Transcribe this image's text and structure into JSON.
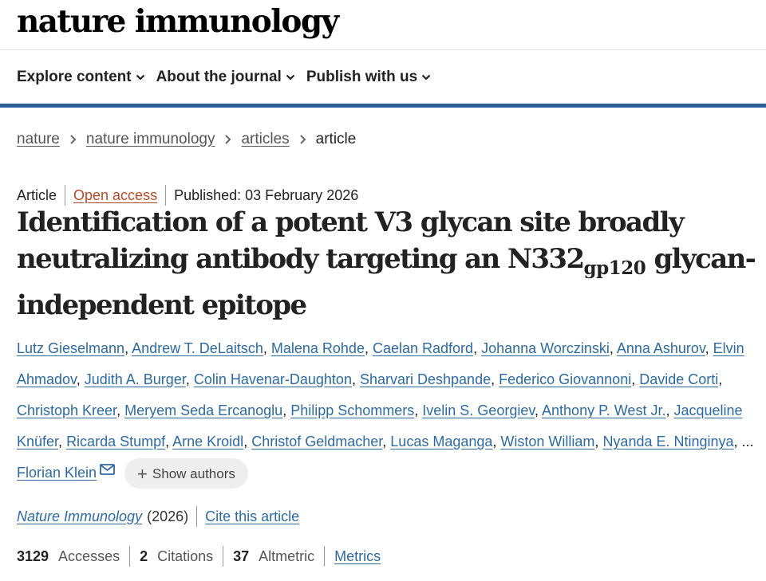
{
  "site": {
    "logo": "nature immunology"
  },
  "nav": {
    "items": [
      {
        "label": "Explore content"
      },
      {
        "label": "About the journal"
      },
      {
        "label": "Publish with us"
      }
    ]
  },
  "breadcrumb": {
    "items": [
      "nature",
      "nature immunology",
      "articles"
    ],
    "current": "article"
  },
  "article": {
    "type": "Article",
    "access": "Open access",
    "published": "Published: 03 February 2026",
    "title_part1": "Identification of a potent V3 glycan site broadly neutralizing antibody targeting an N332",
    "title_sub": "gp120",
    "title_part2": " glycan-independent epitope",
    "authors": [
      "Lutz Gieselmann",
      "Andrew T. DeLaitsch",
      "Malena Rohde",
      "Caelan Radford",
      "Johanna Worczinski",
      "Anna Ashurov",
      "Elvin Ahmadov",
      "Judith A. Burger",
      "Colin Havenar-Daughton",
      "Sharvari Deshpande",
      "Federico Giovannoni",
      "Davide Corti",
      "Christoph Kreer",
      "Meryem Seda Ercanoglu",
      "Philipp Schommers",
      "Ivelin S. Georgiev",
      "Anthony P. West Jr.",
      "Jacqueline Knüfer",
      "Ricarda Stumpf",
      "Arne Kroidl",
      "Christof Geldmacher",
      "Lucas Maganga",
      "Wiston William",
      "Nyanda E. Ntinginya"
    ],
    "ellipsis": "...",
    "last_author": "Florian Klein",
    "show_authors": "Show authors",
    "journal": "Nature Immunology",
    "year": "(2026)",
    "cite": "Cite this article",
    "metrics": {
      "accesses_value": "3129",
      "accesses_label": "Accesses",
      "citations_value": "2",
      "citations_label": "Citations",
      "altmetric_value": "37",
      "altmetric_label": "Altmetric",
      "link": "Metrics"
    }
  },
  "colors": {
    "accent_bar": "#2e5c95",
    "link": "#2e6a9f",
    "open_access": "#b44a2b"
  }
}
